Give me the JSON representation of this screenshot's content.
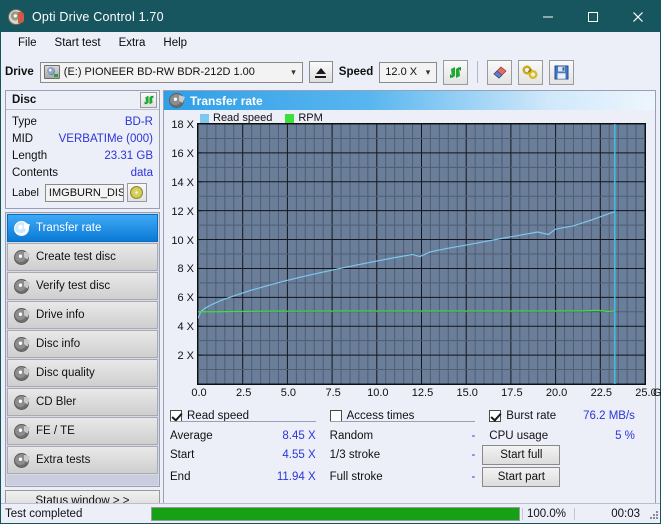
{
  "window": {
    "title": "Opti Drive Control 1.70",
    "icon": "disc-icon",
    "minimize": "minimize-icon",
    "maximize": "maximize-icon",
    "close": "close-icon"
  },
  "menu": {
    "items": [
      "File",
      "Start test",
      "Extra",
      "Help"
    ]
  },
  "toolbar": {
    "drive_label": "Drive",
    "drive_value": "(E:)  PIONEER BD-RW  BDR-212D 1.00",
    "eject_icon": "eject-icon",
    "speed_label": "Speed",
    "speed_value": "12.0 X",
    "refresh_icon": "refresh-icon",
    "erase_icon": "eraser-icon",
    "tools_icon": "tools-icon",
    "save_icon": "save-icon"
  },
  "disc": {
    "header": "Disc",
    "refresh_icon": "refresh-icon",
    "rows": [
      {
        "key": "Type",
        "value": "BD-R"
      },
      {
        "key": "MID",
        "value": "VERBATIMe (000)"
      },
      {
        "key": "Length",
        "value": "23.31 GB"
      },
      {
        "key": "Contents",
        "value": "data"
      }
    ],
    "label_key": "Label",
    "label_value": "IMGBURN_DIS",
    "label_icon": "cd-icon"
  },
  "tabs": {
    "items": [
      {
        "label": "Transfer rate",
        "active": true
      },
      {
        "label": "Create test disc",
        "active": false
      },
      {
        "label": "Verify test disc",
        "active": false
      },
      {
        "label": "Drive info",
        "active": false
      },
      {
        "label": "Disc info",
        "active": false
      },
      {
        "label": "Disc quality",
        "active": false
      },
      {
        "label": "CD Bler",
        "active": false
      },
      {
        "label": "FE / TE",
        "active": false
      },
      {
        "label": "Extra tests",
        "active": false
      }
    ],
    "status_window": "Status window > >"
  },
  "panel": {
    "title": "Transfer rate",
    "icon": "disc-icon"
  },
  "chart_data": {
    "type": "line",
    "title": "Transfer rate",
    "xlabel": "GB",
    "ylabel": "X",
    "xunit": "GB",
    "xlim": [
      0,
      25
    ],
    "ylim": [
      0,
      18
    ],
    "xticks": [
      0.0,
      2.5,
      5.0,
      7.5,
      10.0,
      12.5,
      15.0,
      17.5,
      20.0,
      22.5,
      25.0
    ],
    "xticklabels": [
      "0.0",
      "2.5",
      "5.0",
      "7.5",
      "10.0",
      "12.5",
      "15.0",
      "17.5",
      "20.0",
      "22.5",
      "25.0"
    ],
    "yticks": [
      2,
      4,
      6,
      8,
      10,
      12,
      14,
      16,
      18
    ],
    "yticklabels": [
      "2 X",
      "4 X",
      "6 X",
      "8 X",
      "10 X",
      "12 X",
      "14 X",
      "16 X",
      "18 X"
    ],
    "grid": true,
    "plot_bg": "#6a7d99",
    "legend_position": "top-left",
    "legend": [
      {
        "name": "Read speed",
        "color": "#7ec8f0"
      },
      {
        "name": "RPM",
        "color": "#3ce03c"
      }
    ],
    "marker_line": {
      "x": 23.31,
      "color": "#35c6ee"
    },
    "series": [
      {
        "name": "Read speed",
        "color": "#7ec8f0",
        "x": [
          0.0,
          0.15,
          0.4,
          0.8,
          1.3,
          2.0,
          3.0,
          4.0,
          5.0,
          6.0,
          7.0,
          8.0,
          9.0,
          10.0,
          11.0,
          12.0,
          12.4,
          13.0,
          14.0,
          15.0,
          16.0,
          17.0,
          18.0,
          19.0,
          19.6,
          20.0,
          21.0,
          22.0,
          23.0,
          23.31
        ],
        "y": [
          4.55,
          5.0,
          5.25,
          5.52,
          5.79,
          6.1,
          6.5,
          6.85,
          7.18,
          7.47,
          7.75,
          8.02,
          8.27,
          8.51,
          8.75,
          8.97,
          8.82,
          9.15,
          9.4,
          9.62,
          9.85,
          10.08,
          10.3,
          10.52,
          10.35,
          10.72,
          10.95,
          11.35,
          11.8,
          11.94
        ]
      },
      {
        "name": "RPM",
        "color": "#3ce03c",
        "x": [
          0.0,
          1.0,
          2.0,
          4.6,
          5.2,
          8.0,
          12.0,
          16.0,
          19.7,
          21.5,
          22.4,
          22.9,
          23.31
        ],
        "y": [
          5.0,
          5.0,
          5.02,
          5.05,
          5.04,
          5.05,
          5.05,
          5.05,
          5.05,
          5.06,
          5.1,
          5.02,
          5.05
        ]
      }
    ]
  },
  "results": {
    "read_speed_label": "Read speed",
    "read_speed_checked": true,
    "access_times_label": "Access times",
    "access_times_checked": false,
    "burst_rate_label": "Burst rate",
    "burst_rate_checked": true,
    "burst_rate_value": "76.2 MB/s",
    "rows": [
      {
        "k1": "Average",
        "v1": "8.45 X",
        "k2": "Random",
        "v2": "-",
        "k3": "CPU usage",
        "v3": "5 %"
      },
      {
        "k1": "Start",
        "v1": "4.55 X",
        "k2": "1/3 stroke",
        "v2": "-",
        "k3": "",
        "v3": ""
      },
      {
        "k1": "End",
        "v1": "11.94 X",
        "k2": "Full stroke",
        "v2": "-",
        "k3": "",
        "v3": ""
      }
    ],
    "start_full": "Start full",
    "start_part": "Start part"
  },
  "statusbar": {
    "text": "Test completed",
    "percent_label": "100.0%",
    "percent_value": 100,
    "time": "00:03",
    "bar_color": "#15a015"
  }
}
